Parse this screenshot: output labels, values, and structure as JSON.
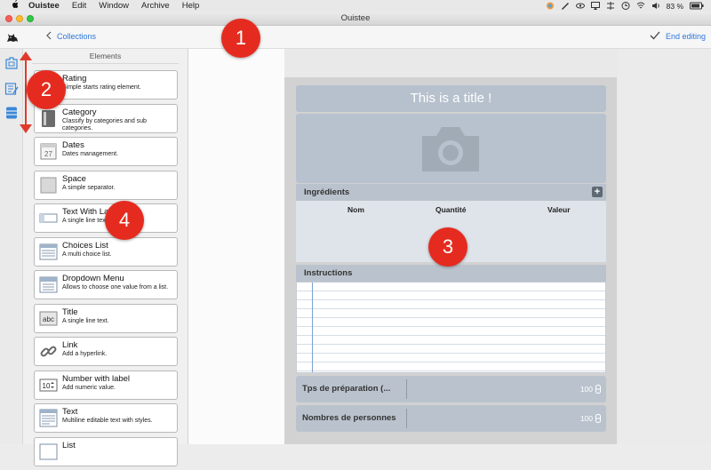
{
  "menubar": {
    "items": [
      "Ouistee",
      "Edit",
      "Window",
      "Archive",
      "Help"
    ],
    "battery": "83 %"
  },
  "window": {
    "title": "Ouistee"
  },
  "toolbar": {
    "back_label": "Collections",
    "end_editing_label": "End editing"
  },
  "elements_panel": {
    "header": "Elements",
    "items": [
      {
        "title": "Rating",
        "desc": "Simple starts rating element.",
        "icon": "star-icon"
      },
      {
        "title": "Category",
        "desc": "Classify by categories and sub categories.",
        "icon": "category-icon"
      },
      {
        "title": "Dates",
        "desc": "Dates management.",
        "icon": "calendar-icon",
        "icon_text": "27"
      },
      {
        "title": "Space",
        "desc": "A simple separator.",
        "icon": "space-icon"
      },
      {
        "title": "Text With Label",
        "desc": "A single line text field.",
        "icon": "text-field-icon"
      },
      {
        "title": "Choices List",
        "desc": "A multi choice list.",
        "icon": "list-icon"
      },
      {
        "title": "Dropdown Menu",
        "desc": "Allows to choose one value from a list.",
        "icon": "dropdown-icon"
      },
      {
        "title": "Title",
        "desc": "A single line text.",
        "icon": "title-icon",
        "icon_text": "abc"
      },
      {
        "title": "Link",
        "desc": "Add a hyperlink.",
        "icon": "link-icon"
      },
      {
        "title": "Number with label",
        "desc": "Add numeric value.",
        "icon": "number-icon",
        "icon_text": "10"
      },
      {
        "title": "Text",
        "desc": "Multiline editable text with styles.",
        "icon": "text-icon"
      },
      {
        "title": "List",
        "desc": "",
        "icon": "list-icon"
      }
    ]
  },
  "canvas": {
    "title": "This is a title !",
    "ingredients": {
      "header": "Ingrédients",
      "columns": [
        "Nom",
        "Quantité",
        "Valeur"
      ]
    },
    "instructions": {
      "header": "Instructions"
    },
    "prep_time": {
      "label": "Tps de préparation (...",
      "value": "100"
    },
    "persons": {
      "label": "Nombres de personnes",
      "value": "100"
    }
  },
  "annotations": [
    "1",
    "2",
    "3",
    "4"
  ],
  "colors": {
    "accent": "#2f76d8",
    "badge": "#e52b1f",
    "block": "#b6c1cd"
  }
}
